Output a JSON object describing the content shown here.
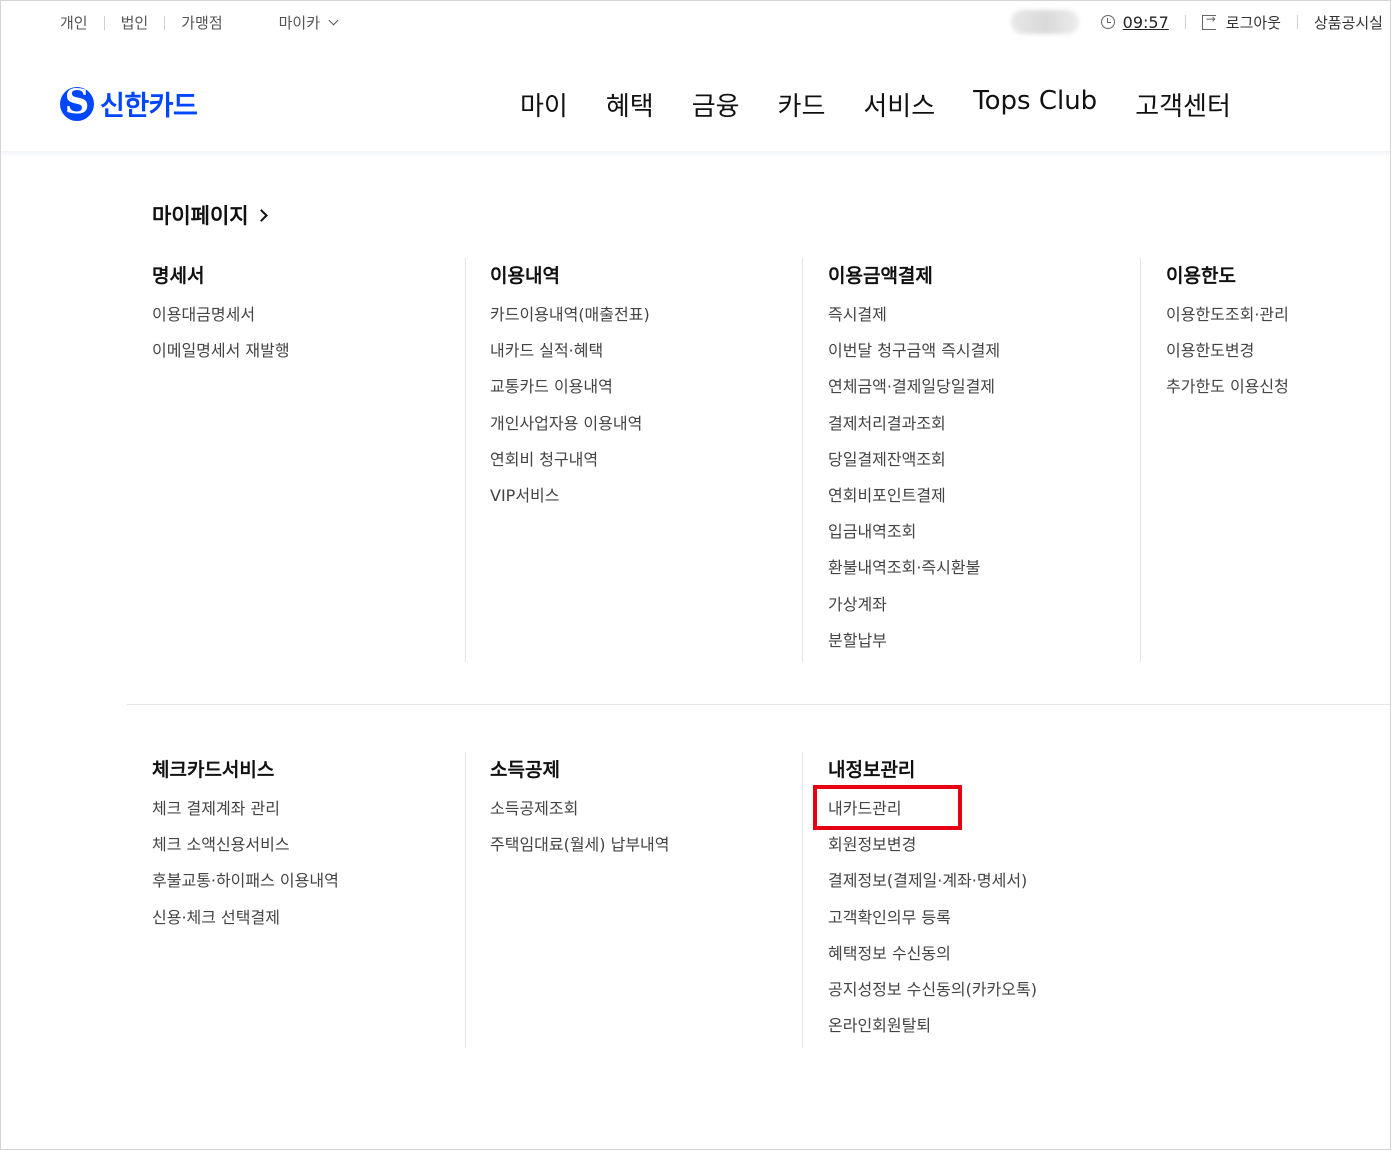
{
  "util": {
    "left": [
      "개인",
      "법인",
      "가맹점"
    ],
    "myca": "마이카",
    "time": "09:57",
    "logout": "로그아웃",
    "notice": "상품공시실"
  },
  "brand": {
    "name": "신한카드",
    "color": "#0046ff"
  },
  "gnb": [
    "마이",
    "혜택",
    "금융",
    "카드",
    "서비스",
    "Tops Club",
    "고객센터"
  ],
  "mypage": {
    "title": "마이페이지"
  },
  "sections": [
    {
      "title": "명세서",
      "items": [
        "이용대금명세서",
        "이메일명세서 재발행"
      ]
    },
    {
      "title": "이용내역",
      "items": [
        "카드이용내역(매출전표)",
        "내카드 실적·혜택",
        "교통카드 이용내역",
        "개인사업자용 이용내역",
        "연회비 청구내역",
        "VIP서비스"
      ]
    },
    {
      "title": "이용금액결제",
      "items": [
        "즉시결제",
        "이번달 청구금액 즉시결제",
        "연체금액·결제일당일결제",
        "결제처리결과조회",
        "당일결제잔액조회",
        "연회비포인트결제",
        "입금내역조회",
        "환불내역조회·즉시환불",
        "가상계좌",
        "분할납부"
      ]
    },
    {
      "title": "이용한도",
      "items": [
        "이용한도조회·관리",
        "이용한도변경",
        "추가한도 이용신청"
      ]
    },
    {
      "title": "체크카드서비스",
      "items": [
        "체크 결제계좌 관리",
        "체크 소액신용서비스",
        "후불교통·하이패스 이용내역",
        "신용·체크 선택결제"
      ]
    },
    {
      "title": "소득공제",
      "items": [
        "소득공제조회",
        "주택임대료(월세) 납부내역"
      ]
    },
    {
      "title": "내정보관리",
      "items": [
        "내카드관리",
        "회원정보변경",
        "결제정보(결제일·계좌·명세서)",
        "고객확인의무 등록",
        "혜택정보 수신동의",
        "공지성정보 수신동의(카카오톡)",
        "온라인회원탈퇴"
      ]
    }
  ],
  "highlight_color": "#e60012"
}
